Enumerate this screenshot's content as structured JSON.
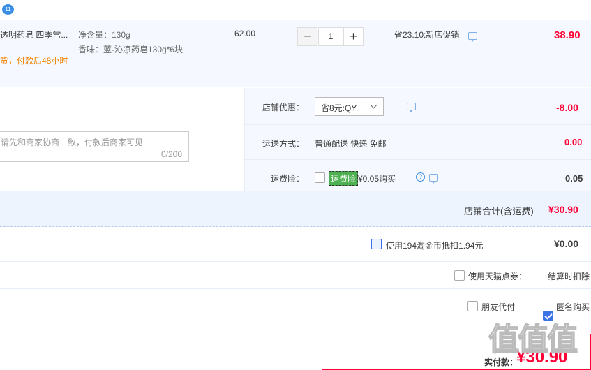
{
  "product": {
    "badge": "11",
    "title": "透明药皂 四季常...",
    "promise": "货，付款后48小时",
    "spec_weight": "净含量：130g",
    "spec_scent": "香味：蓝-沁凉药皂130g*6块",
    "unit_price": "62.00",
    "quantity": "1",
    "qty_minus": "−",
    "qty_plus": "+",
    "discount_note": "省23.10:新店促销",
    "subtotal": "38.90"
  },
  "message": {
    "placeholder": "请先和商家协商一致，付款后商家可见",
    "counter": "0/200"
  },
  "shop": {
    "discount_label": "店铺优惠：",
    "discount_select": "省8元:QY",
    "discount_value": "-8.00",
    "shipping_label": "运送方式：",
    "shipping_text": "普通配送 快递 免邮",
    "shipping_value": "0.00",
    "insurance_label": "运费险：",
    "insurance_tag": "运费险",
    "insurance_text": "¥0.05购买",
    "insurance_value": "0.05",
    "total_label": "店铺合计(含运费)",
    "total_value": "¥30.90"
  },
  "taobao_coin": {
    "label": "使用194淘金币抵扣1.94元",
    "value": "¥0.00"
  },
  "tmall_points": {
    "label": "使用天猫点券：",
    "note": "结算时扣除"
  },
  "options": {
    "friend_pay": "朋友代付",
    "anonymous": "匿名购买"
  },
  "payment": {
    "label": "实付款：",
    "value": "¥30.90"
  },
  "watermark": "值值值",
  "colors": {
    "accent": "#ff0036",
    "border_blue": "#b8cbe6",
    "row_bg": "#f5f9ff",
    "tag_green": "#4caf50"
  }
}
